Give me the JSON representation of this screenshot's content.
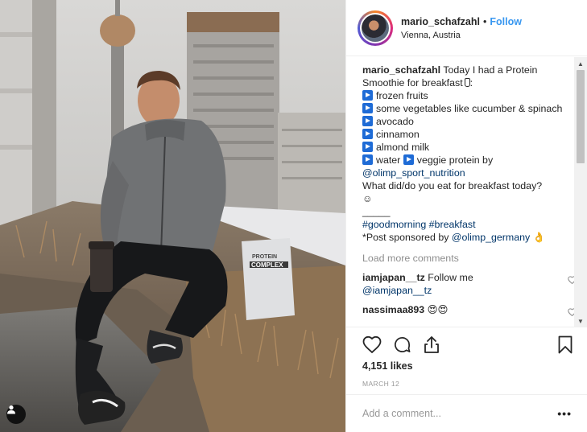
{
  "post": {
    "username": "mario_schafzahl",
    "follow_label": "Follow",
    "separator": "•",
    "location": "Vienna, Austria",
    "caption_intro": "Today I had a Protein Smoothie for breakfast",
    "caption_intro_tail": ":",
    "caption_items": [
      "frozen fruits",
      "some vegetables like cucumber & spinach",
      "avocado",
      "cinnamon",
      "almond milk"
    ],
    "caption_water": "water",
    "caption_veggie": "veggie protein by",
    "caption_mention_1": "@olimp_sport_nutrition",
    "caption_question": "What did/do you eat for breakfast today?",
    "caption_emoji": "☺",
    "caption_rule": "_____",
    "hashtags": "#goodmorning #breakfast",
    "sponsor_text": "*Post sponsored by",
    "sponsor_mention": "@olimp_germany",
    "sponsor_emoji": "👌",
    "load_more": "Load more comments",
    "comments": [
      {
        "user": "iamjapan__tz",
        "text": "Follow me",
        "mention": "@iamjapan__tz"
      },
      {
        "user": "nassimaa893",
        "text": "😍😍"
      }
    ],
    "likes": "4,151 likes",
    "date": "MARCH 12",
    "add_comment_placeholder": "Add a comment...",
    "more_label": "•••"
  },
  "photo": {
    "product_label_top": "PROTEIN",
    "product_label_main": "COMPLEX"
  },
  "colors": {
    "accent": "#3897f0",
    "link": "#003569",
    "muted": "#8e8e8e"
  }
}
